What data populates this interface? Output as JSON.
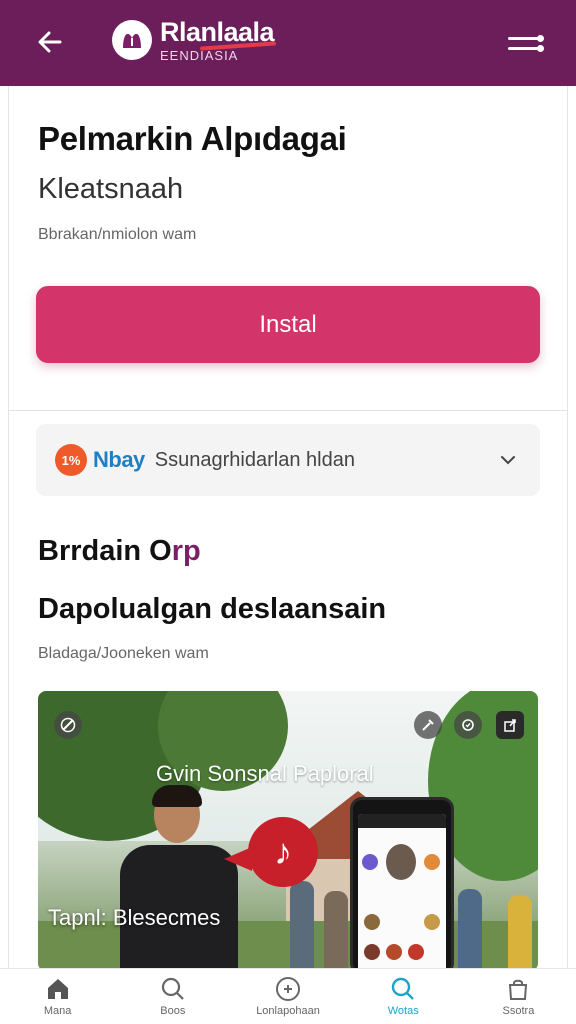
{
  "header": {
    "brand_name": "Rlanlaala",
    "brand_sub": "EENDIASIA",
    "back_icon": "arrow-left-icon",
    "menu_icon": "menu-icon",
    "background": "#6b1e5a"
  },
  "app": {
    "title": "Pelmarkin Alpıdagai",
    "subtitle": "Kleatsnaah",
    "caption": "Bbrakan/nmiolon wam",
    "install_label": "Instal",
    "install_color": "#d3346a"
  },
  "dropdown": {
    "brand": "Nbay",
    "logo_text": "1%",
    "text": "Ssunagrhidarlan hldan"
  },
  "section": {
    "heading_part1": "Brrdain O",
    "heading_part2": "rp",
    "heading2": "Dapolualgan deslaansain",
    "caption": "Bladaga/Jooneken wam"
  },
  "media": {
    "overlay_title": "Gvin Sonsnal Paploral",
    "caption": "Tapnl: Blesecmes",
    "music_icon": "music-note-icon"
  },
  "bottom_nav": {
    "items": [
      {
        "label": "Mana",
        "icon": "home-icon"
      },
      {
        "label": "Boos",
        "icon": "search-icon"
      },
      {
        "label": "Lonlapohaan",
        "icon": "add-box-icon"
      },
      {
        "label": "Wotas",
        "icon": "search-icon",
        "active": true
      },
      {
        "label": "Ssotra",
        "icon": "bag-icon"
      }
    ],
    "active_color": "#1ea3c9"
  }
}
